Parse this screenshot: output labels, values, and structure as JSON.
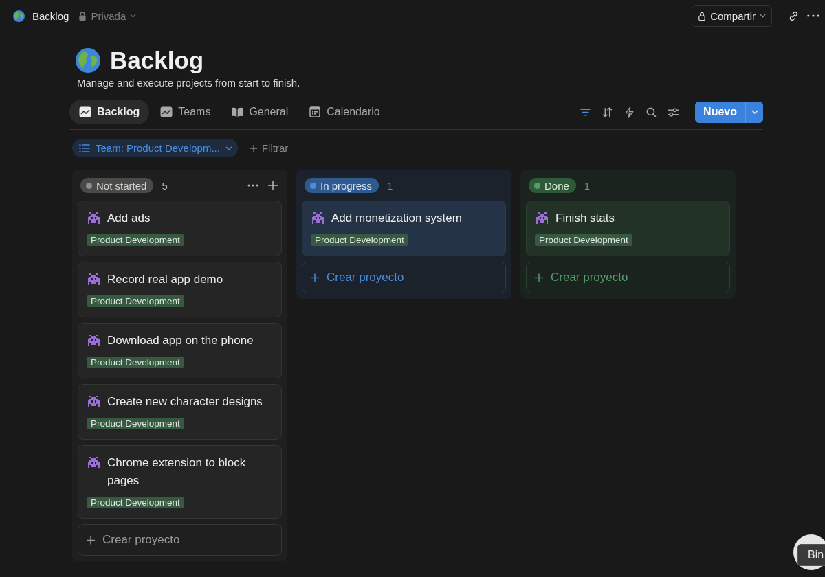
{
  "topbar": {
    "title": "Backlog",
    "privacy": "Privada",
    "share": "Compartir"
  },
  "page": {
    "title": "Backlog",
    "description": "Manage and execute projects from start to finish."
  },
  "views": [
    {
      "label": "Backlog",
      "kind": "chart",
      "selected": true
    },
    {
      "label": "Teams",
      "kind": "chart",
      "selected": false
    },
    {
      "label": "General",
      "kind": "book",
      "selected": false
    },
    {
      "label": "Calendario",
      "kind": "calendar",
      "selected": false
    }
  ],
  "toolbar": {
    "filter_active": true,
    "new_button": "Nuevo"
  },
  "filters": [
    {
      "label": "Team: Product Developm..."
    }
  ],
  "add_filter": "Filtrar",
  "columns": [
    {
      "kind": "gray",
      "status": "Not started",
      "count": "5",
      "color": "#8e8e8e",
      "show_actions": true,
      "add_label": "Crear proyecto",
      "cards": [
        {
          "title": "Add ads",
          "tag": "Product Development"
        },
        {
          "title": "Record real app demo",
          "tag": "Product Development"
        },
        {
          "title": "Download app on the phone",
          "tag": "Product Development"
        },
        {
          "title": "Create new character designs",
          "tag": "Product Development"
        },
        {
          "title": "Chrome extension to block pages",
          "tag": "Product Development"
        }
      ]
    },
    {
      "kind": "blue",
      "status": "In progress",
      "count": "1",
      "color": "#4a8fe0",
      "show_actions": false,
      "add_label": "Crear proyecto",
      "cards": [
        {
          "title": "Add monetization system",
          "tag": "Product Development"
        }
      ]
    },
    {
      "kind": "green",
      "status": "Done",
      "count": "1",
      "color": "#55a06a",
      "show_actions": false,
      "add_label": "Crear proyecto",
      "cards": [
        {
          "title": "Finish stats",
          "tag": "Product Development"
        }
      ]
    }
  ],
  "tooltip": "Bin"
}
